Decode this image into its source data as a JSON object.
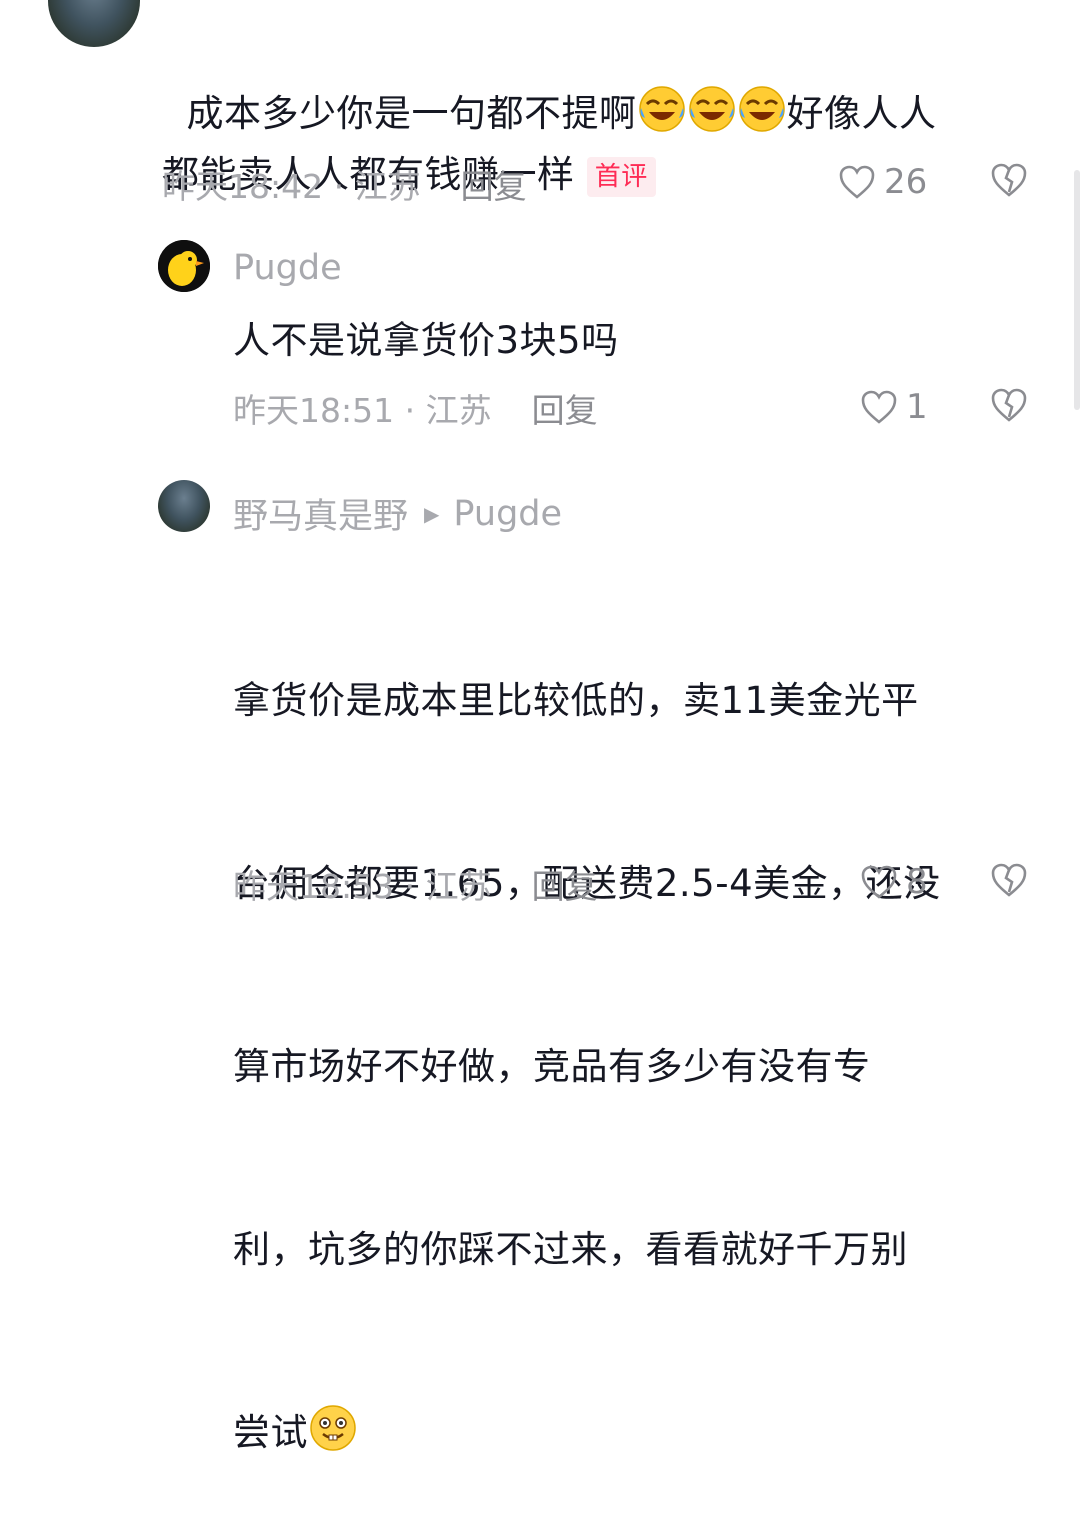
{
  "comments": [
    {
      "text_line1": "成本多少你是一句都不提啊",
      "text_line1_tail": "好像人人",
      "text_line2": "都能卖人人都有钱赚一样",
      "tag": "首评",
      "time_location": "昨天18:42 · 江苏",
      "reply_label": "回复",
      "likes": "26"
    },
    {
      "username": "Pugde",
      "text": "人不是说拿货价3块5吗",
      "time_location": "昨天18:51 · 江苏",
      "reply_label": "回复",
      "likes": "1"
    },
    {
      "username": "野马真是野",
      "reply_to": "Pugde",
      "text_lines": [
        "拿货价是成本里比较低的，卖11美金光平",
        "台佣金都要1.65，配送费2.5-4美金，还没",
        "算市场好不好做，竞品有多少有没有专",
        "利，坑多的你踩不过来，看看就好千万别",
        "尝试"
      ],
      "time_location": "昨天18:53 · 江苏",
      "reply_label": "回复",
      "likes": "8"
    }
  ],
  "colors": {
    "accent": "#fe2c55",
    "meta": "#a8a9ae",
    "text": "#161823"
  },
  "icons": [
    "heart-icon",
    "dislike-icon",
    "laugh-cry-emoji",
    "grin-emoji",
    "reply-arrow-icon"
  ]
}
